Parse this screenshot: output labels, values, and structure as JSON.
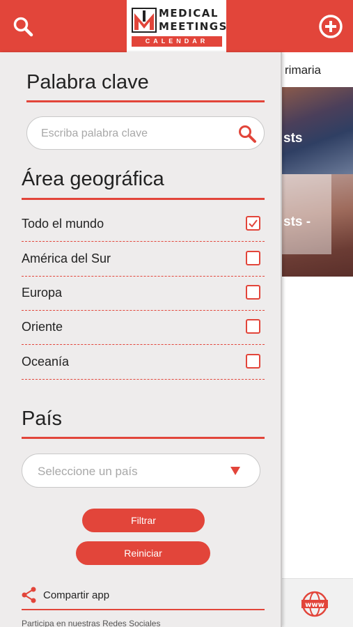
{
  "header": {
    "logo_line1": "MEDICAL",
    "logo_line2": "MEETINGS",
    "logo_line3": "CALENDAR",
    "search_icon": "search-icon",
    "add_icon": "add-circle-icon"
  },
  "background": {
    "tab_label": "rimaria",
    "card1_title": "sts",
    "card2_title": "sts -",
    "bottom_icon": "www-globe-icon"
  },
  "filters": {
    "keyword": {
      "title": "Palabra clave",
      "placeholder": "Escriba palabra clave"
    },
    "area": {
      "title": "Área geográfica",
      "options": [
        {
          "label": "Todo el mundo",
          "checked": true
        },
        {
          "label": "América del Sur",
          "checked": false
        },
        {
          "label": "Europa",
          "checked": false
        },
        {
          "label": "Oriente",
          "checked": false
        },
        {
          "label": "Oceanía",
          "checked": false
        }
      ]
    },
    "country": {
      "title": "País",
      "placeholder": "Seleccione un país"
    },
    "filter_button": "Filtrar",
    "reset_button": "Reiniciar",
    "share_label": "Compartir app",
    "social_label": "Participa en nuestras Redes Sociales"
  },
  "colors": {
    "accent": "#e2453a",
    "panel_bg": "#eeecec"
  }
}
